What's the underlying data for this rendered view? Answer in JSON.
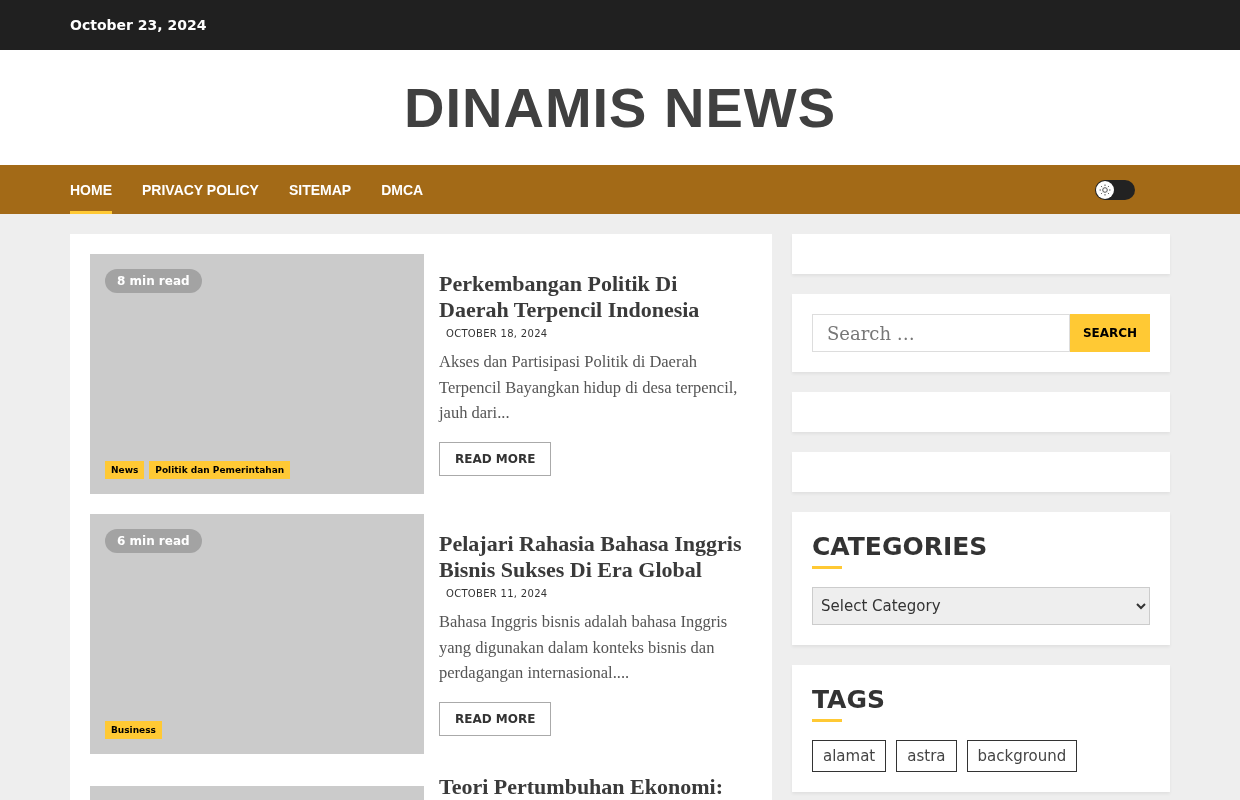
{
  "top_bar": {
    "date": "October 23, 2024"
  },
  "site_title": "DINAMIS NEWS",
  "nav": {
    "items": [
      {
        "label": "HOME",
        "selected": true
      },
      {
        "label": "PRIVACY POLICY",
        "selected": false
      },
      {
        "label": "SITEMAP",
        "selected": false
      },
      {
        "label": "DMCA",
        "selected": false
      }
    ],
    "dark_mode_toggle": {
      "on": false
    }
  },
  "posts": [
    {
      "read_time": "8 min read",
      "categories": [
        "News",
        "Politik dan Pemerintahan"
      ],
      "title": "Perkembangan Politik Di Daerah Terpencil Indonesia",
      "date": "OCTOBER 18, 2024",
      "excerpt": "Akses dan Partisipasi Politik di Daerah Terpencil Bayangkan hidup di desa terpencil, jauh dari...",
      "button": "READ MORE"
    },
    {
      "read_time": "6 min read",
      "categories": [
        "Business"
      ],
      "title": "Pelajari Rahasia Bahasa Inggris Bisnis Sukses Di Era Global",
      "date": "OCTOBER 11, 2024",
      "excerpt": "Bahasa Inggris bisnis adalah bahasa Inggris yang digunakan dalam konteks bisnis dan perdagangan internasional....",
      "button": "READ MORE"
    },
    {
      "title": "Teori Pertumbuhan Ekonomi:"
    }
  ],
  "sidebar": {
    "widgets": [
      {
        "kind": "empty"
      },
      {
        "kind": "search",
        "placeholder": "Search …",
        "button": "SEARCH"
      },
      {
        "kind": "empty"
      },
      {
        "kind": "empty"
      },
      {
        "kind": "select",
        "title": "CATEGORIES",
        "value": "Select Category"
      },
      {
        "kind": "tags",
        "title": "TAGS",
        "tags": [
          "alamat",
          "astra",
          "background"
        ]
      }
    ]
  }
}
